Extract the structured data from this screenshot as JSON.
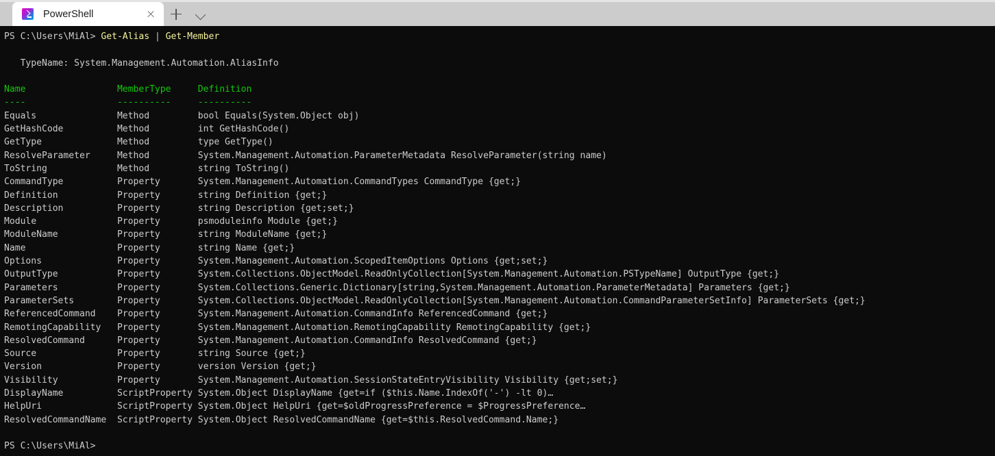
{
  "window": {
    "tab": {
      "title": "PowerShell",
      "icon": "powershell-icon",
      "close_icon": "close-icon"
    },
    "new_tab_icon": "plus-icon",
    "dropdown_icon": "chevron-down-icon"
  },
  "colors": {
    "background": "#0c0c0c",
    "foreground": "#cccccc",
    "command": "#f3f39a",
    "header": "#16c60c",
    "titlebar": "#cccccc",
    "tab_active": "#ffffff"
  },
  "terminal": {
    "prompt_1": {
      "prompt": "PS C:\\Users\\MiAl> ",
      "cmd1": "Get-Alias",
      "pipe": " | ",
      "cmd2": "Get-Member"
    },
    "typename": "   TypeName: System.Management.Automation.AliasInfo",
    "headers": {
      "name": "Name",
      "membertype": "MemberType",
      "definition": "Definition",
      "name_rule": "----",
      "membertype_rule": "----------",
      "definition_rule": "----------"
    },
    "header_line": "Name                 MemberType     Definition",
    "rule_line": "----                 ----------     ----------",
    "rows": [
      {
        "name": "Equals",
        "membertype": "Method",
        "definition": "bool Equals(System.Object obj)"
      },
      {
        "name": "GetHashCode",
        "membertype": "Method",
        "definition": "int GetHashCode()"
      },
      {
        "name": "GetType",
        "membertype": "Method",
        "definition": "type GetType()"
      },
      {
        "name": "ResolveParameter",
        "membertype": "Method",
        "definition": "System.Management.Automation.ParameterMetadata ResolveParameter(string name)"
      },
      {
        "name": "ToString",
        "membertype": "Method",
        "definition": "string ToString()"
      },
      {
        "name": "CommandType",
        "membertype": "Property",
        "definition": "System.Management.Automation.CommandTypes CommandType {get;}"
      },
      {
        "name": "Definition",
        "membertype": "Property",
        "definition": "string Definition {get;}"
      },
      {
        "name": "Description",
        "membertype": "Property",
        "definition": "string Description {get;set;}"
      },
      {
        "name": "Module",
        "membertype": "Property",
        "definition": "psmoduleinfo Module {get;}"
      },
      {
        "name": "ModuleName",
        "membertype": "Property",
        "definition": "string ModuleName {get;}"
      },
      {
        "name": "Name",
        "membertype": "Property",
        "definition": "string Name {get;}"
      },
      {
        "name": "Options",
        "membertype": "Property",
        "definition": "System.Management.Automation.ScopedItemOptions Options {get;set;}"
      },
      {
        "name": "OutputType",
        "membertype": "Property",
        "definition": "System.Collections.ObjectModel.ReadOnlyCollection[System.Management.Automation.PSTypeName] OutputType {get;}"
      },
      {
        "name": "Parameters",
        "membertype": "Property",
        "definition": "System.Collections.Generic.Dictionary[string,System.Management.Automation.ParameterMetadata] Parameters {get;}"
      },
      {
        "name": "ParameterSets",
        "membertype": "Property",
        "definition": "System.Collections.ObjectModel.ReadOnlyCollection[System.Management.Automation.CommandParameterSetInfo] ParameterSets {get;}"
      },
      {
        "name": "ReferencedCommand",
        "membertype": "Property",
        "definition": "System.Management.Automation.CommandInfo ReferencedCommand {get;}"
      },
      {
        "name": "RemotingCapability",
        "membertype": "Property",
        "definition": "System.Management.Automation.RemotingCapability RemotingCapability {get;}"
      },
      {
        "name": "ResolvedCommand",
        "membertype": "Property",
        "definition": "System.Management.Automation.CommandInfo ResolvedCommand {get;}"
      },
      {
        "name": "Source",
        "membertype": "Property",
        "definition": "string Source {get;}"
      },
      {
        "name": "Version",
        "membertype": "Property",
        "definition": "version Version {get;}"
      },
      {
        "name": "Visibility",
        "membertype": "Property",
        "definition": "System.Management.Automation.SessionStateEntryVisibility Visibility {get;set;}"
      },
      {
        "name": "DisplayName",
        "membertype": "ScriptProperty",
        "definition": "System.Object DisplayName {get=if ($this.Name.IndexOf('-') -lt 0)…"
      },
      {
        "name": "HelpUri",
        "membertype": "ScriptProperty",
        "definition": "System.Object HelpUri {get=$oldProgressPreference = $ProgressPreference…"
      },
      {
        "name": "ResolvedCommandName",
        "membertype": "ScriptProperty",
        "definition": "System.Object ResolvedCommandName {get=$this.ResolvedCommand.Name;}"
      }
    ],
    "prompt_2": "PS C:\\Users\\MiAl> "
  }
}
